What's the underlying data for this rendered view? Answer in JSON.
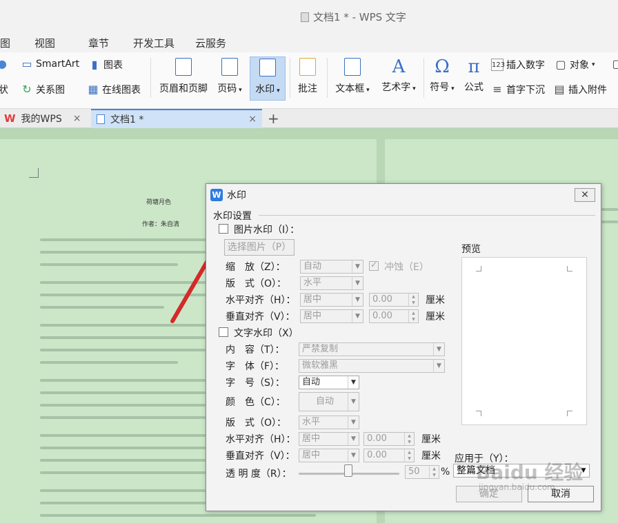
{
  "window": {
    "title": "文档1 * - WPS 文字"
  },
  "menu": {
    "items": [
      "图",
      "视图",
      "章节",
      "开发工具",
      "云服务"
    ]
  },
  "ribbon": {
    "smartart": "SmartArt",
    "chart": "图表",
    "shape_cut": "状",
    "relation": "关系图",
    "online_chart": "在线图表",
    "header_footer": "页眉和页脚",
    "page_number": "页码",
    "watermark": "水印",
    "comment": "批注",
    "textbox": "文本框",
    "wordart": "艺术字",
    "symbol": "符号",
    "formula": "公式",
    "insert_number": "插入数字",
    "object": "对象",
    "drop_cap": "首字下沉",
    "attachment": "插入附件"
  },
  "tabs": {
    "home": "我的WPS",
    "doc": "文档1 *",
    "close": "×",
    "add": "+"
  },
  "document": {
    "title": "荷塘月色",
    "author": "作者：朱自清"
  },
  "dialog": {
    "title": "水印",
    "close": "✕",
    "section": "水印设置",
    "image_wm": "图片水印（I）：",
    "choose_image": "选择图片（P）",
    "scale_label": "缩　放（Z）：",
    "scale_value": "自动",
    "washout": "冲蚀（E）",
    "layout_label": "版　式（O）：",
    "layout_value": "水平",
    "h_align_label": "水平对齐（H）：",
    "h_align_value": "居中",
    "h_offset": "0.00",
    "unit": "厘米",
    "v_align_label": "垂直对齐（V）：",
    "v_align_value": "居中",
    "v_offset": "0.00",
    "text_wm": "文字水印（X）",
    "content_label": "内　容（T）：",
    "content_value": "严禁复制",
    "font_label": "字　体（F）：",
    "font_value": "微软雅黑",
    "size_label": "字　号（S）：",
    "size_value": "自动",
    "color_label": "颜　色（C）：",
    "color_value": "自动",
    "t_layout_label": "版　式（O）：",
    "t_layout_value": "水平",
    "t_h_align_label": "水平对齐（H）：",
    "t_h_align_value": "居中",
    "t_h_offset": "0.00",
    "t_v_align_label": "垂直对齐（V）：",
    "t_v_align_value": "居中",
    "t_v_offset": "0.00",
    "transparency_label": "透 明 度（R）：",
    "transparency_value": "50",
    "percent": "%",
    "preview": "预览",
    "apply_label": "应用于（Y）：",
    "apply_value": "整篇文档",
    "ok": "确定",
    "cancel": "取消"
  },
  "overlay": {
    "brand": "Baidu 经验",
    "site": "jingyan.baidu.com"
  }
}
